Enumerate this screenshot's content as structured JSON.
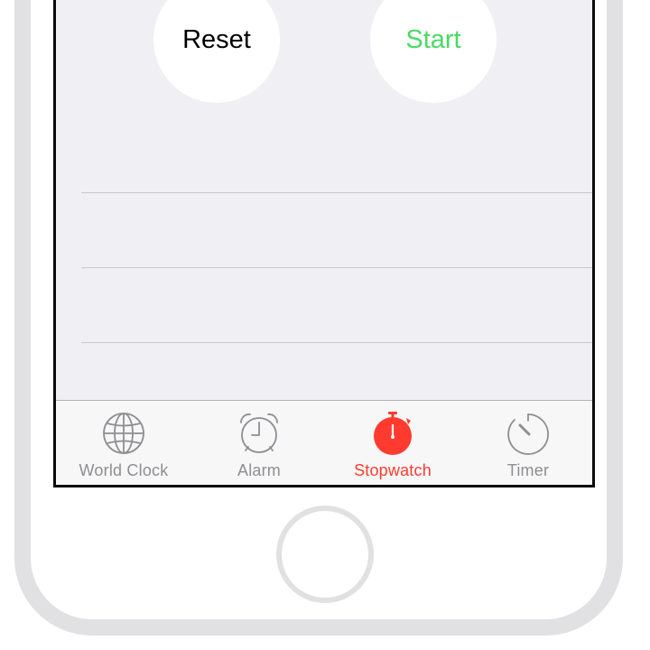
{
  "controls": {
    "reset_label": "Reset",
    "start_label": "Start"
  },
  "tab_bar": {
    "tabs": [
      {
        "label": "World Clock",
        "icon": "globe-icon",
        "active": false
      },
      {
        "label": "Alarm",
        "icon": "alarm-clock-icon",
        "active": false
      },
      {
        "label": "Stopwatch",
        "icon": "stopwatch-icon",
        "active": true
      },
      {
        "label": "Timer",
        "icon": "timer-icon",
        "active": false
      }
    ]
  },
  "colors": {
    "start_green": "#4cd964",
    "active_red": "#ff3b30",
    "inactive_gray": "#8e8e93",
    "screen_background": "#efeff4",
    "tab_bar_background": "#f7f7f7"
  }
}
